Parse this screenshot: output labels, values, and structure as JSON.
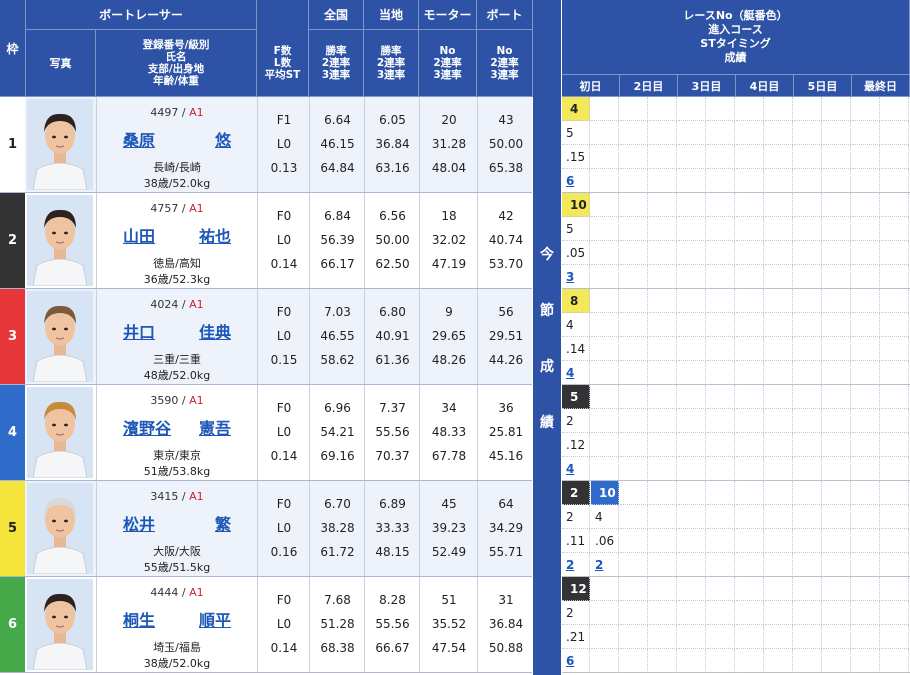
{
  "headers": {
    "waku": "枠",
    "racer": "ボートレーサー",
    "photo": "写真",
    "info_lines": [
      "登録番号/級別",
      "氏名",
      "支部/出身地",
      "年齢/体重"
    ],
    "f_lines": [
      "F数",
      "L数",
      "平均ST"
    ],
    "national": "全国",
    "local": "当地",
    "motor": "モーター",
    "boat": "ボート",
    "rate_lines": [
      "勝率",
      "2連率",
      "3連率"
    ],
    "no_lines": [
      "No",
      "2連率",
      "3連率"
    ],
    "race_lines": [
      "レースNo（艇番色）",
      "進入コース",
      "STタイミング",
      "成績"
    ],
    "days": [
      "初日",
      "2日目",
      "3日目",
      "4日目",
      "5日目",
      "最終日"
    ],
    "vertical": [
      "今",
      "節",
      "成",
      "績"
    ]
  },
  "colors": {
    "header_bg": "#2e53a6",
    "waku": [
      "#ffffff",
      "#333333",
      "#e8373a",
      "#2f6bc8",
      "#f5e43b",
      "#45a94a"
    ],
    "waku_text": [
      "#222222",
      "#ffffff",
      "#ffffff",
      "#ffffff",
      "#222222",
      "#ffffff"
    ]
  },
  "racers": [
    {
      "waku": "1",
      "reg": "4497",
      "cls": "A1",
      "name": [
        "桑原",
        "悠"
      ],
      "branch": "長崎/長崎",
      "age_weight": "38歳/52.0kg",
      "f": "F1",
      "l": "L0",
      "st": "0.13",
      "nat": [
        "6.64",
        "46.15",
        "64.84"
      ],
      "loc": [
        "6.05",
        "36.84",
        "63.16"
      ],
      "motor": [
        "20",
        "31.28",
        "48.04"
      ],
      "boat": [
        "43",
        "50.00",
        "65.38"
      ],
      "results": [
        {
          "race": "4",
          "course": "5",
          "st": ".15",
          "rank": "6"
        }
      ]
    },
    {
      "waku": "2",
      "reg": "4757",
      "cls": "A1",
      "name": [
        "山田",
        "祐也"
      ],
      "branch": "徳島/高知",
      "age_weight": "36歳/52.3kg",
      "f": "F0",
      "l": "L0",
      "st": "0.14",
      "nat": [
        "6.84",
        "56.39",
        "66.17"
      ],
      "loc": [
        "6.56",
        "50.00",
        "62.50"
      ],
      "motor": [
        "18",
        "32.02",
        "47.19"
      ],
      "boat": [
        "42",
        "40.74",
        "53.70"
      ],
      "results": [
        {
          "race": "10",
          "course": "5",
          "st": ".05",
          "rank": "3"
        }
      ]
    },
    {
      "waku": "3",
      "reg": "4024",
      "cls": "A1",
      "name": [
        "井口",
        "佳典"
      ],
      "branch": "三重/三重",
      "age_weight": "48歳/52.0kg",
      "f": "F0",
      "l": "L0",
      "st": "0.15",
      "nat": [
        "7.03",
        "46.55",
        "58.62"
      ],
      "loc": [
        "6.80",
        "40.91",
        "61.36"
      ],
      "motor": [
        "9",
        "29.65",
        "48.26"
      ],
      "boat": [
        "56",
        "29.51",
        "44.26"
      ],
      "results": [
        {
          "race": "8",
          "course": "4",
          "st": ".14",
          "rank": "4"
        }
      ]
    },
    {
      "waku": "4",
      "reg": "3590",
      "cls": "A1",
      "name": [
        "濱野谷",
        "憲吾"
      ],
      "branch": "東京/東京",
      "age_weight": "51歳/53.8kg",
      "f": "F0",
      "l": "L0",
      "st": "0.14",
      "nat": [
        "6.96",
        "54.21",
        "69.16"
      ],
      "loc": [
        "7.37",
        "55.56",
        "70.37"
      ],
      "motor": [
        "34",
        "48.33",
        "67.78"
      ],
      "boat": [
        "36",
        "25.81",
        "45.16"
      ],
      "results": [
        {
          "race": "5",
          "course": "2",
          "st": ".12",
          "rank": "4"
        }
      ]
    },
    {
      "waku": "5",
      "reg": "3415",
      "cls": "A1",
      "name": [
        "松井",
        "繁"
      ],
      "branch": "大阪/大阪",
      "age_weight": "55歳/51.5kg",
      "f": "F0",
      "l": "L0",
      "st": "0.16",
      "nat": [
        "6.70",
        "38.28",
        "61.72"
      ],
      "loc": [
        "6.89",
        "33.33",
        "48.15"
      ],
      "motor": [
        "45",
        "39.23",
        "52.49"
      ],
      "boat": [
        "64",
        "34.29",
        "55.71"
      ],
      "results": [
        {
          "race": "2",
          "course": "2",
          "st": ".11",
          "rank": "2"
        },
        {
          "race": "10",
          "course": "4",
          "st": ".06",
          "rank": "2"
        }
      ]
    },
    {
      "waku": "6",
      "reg": "4444",
      "cls": "A1",
      "name": [
        "桐生",
        "順平"
      ],
      "branch": "埼玉/福島",
      "age_weight": "38歳/52.0kg",
      "f": "F0",
      "l": "L0",
      "st": "0.14",
      "nat": [
        "7.68",
        "51.28",
        "68.38"
      ],
      "loc": [
        "8.28",
        "55.56",
        "66.67"
      ],
      "motor": [
        "51",
        "35.52",
        "47.54"
      ],
      "boat": [
        "31",
        "36.84",
        "50.88"
      ],
      "results": [
        {
          "race": "12",
          "course": "2",
          "st": ".21",
          "rank": "6"
        }
      ]
    }
  ],
  "result_race_colors": [
    {
      "bg": "#f3e85a",
      "fg": "#222222"
    },
    {
      "bg": "#f3e85a",
      "fg": "#222222"
    },
    {
      "bg": "#f3e85a",
      "fg": "#222222"
    },
    {
      "bg": "#333333",
      "fg": "#ffffff"
    },
    [
      {
        "bg": "#333333",
        "fg": "#ffffff"
      },
      {
        "bg": "#2f6bc8",
        "fg": "#ffffff"
      }
    ],
    {
      "bg": "#333333",
      "fg": "#ffffff"
    }
  ]
}
